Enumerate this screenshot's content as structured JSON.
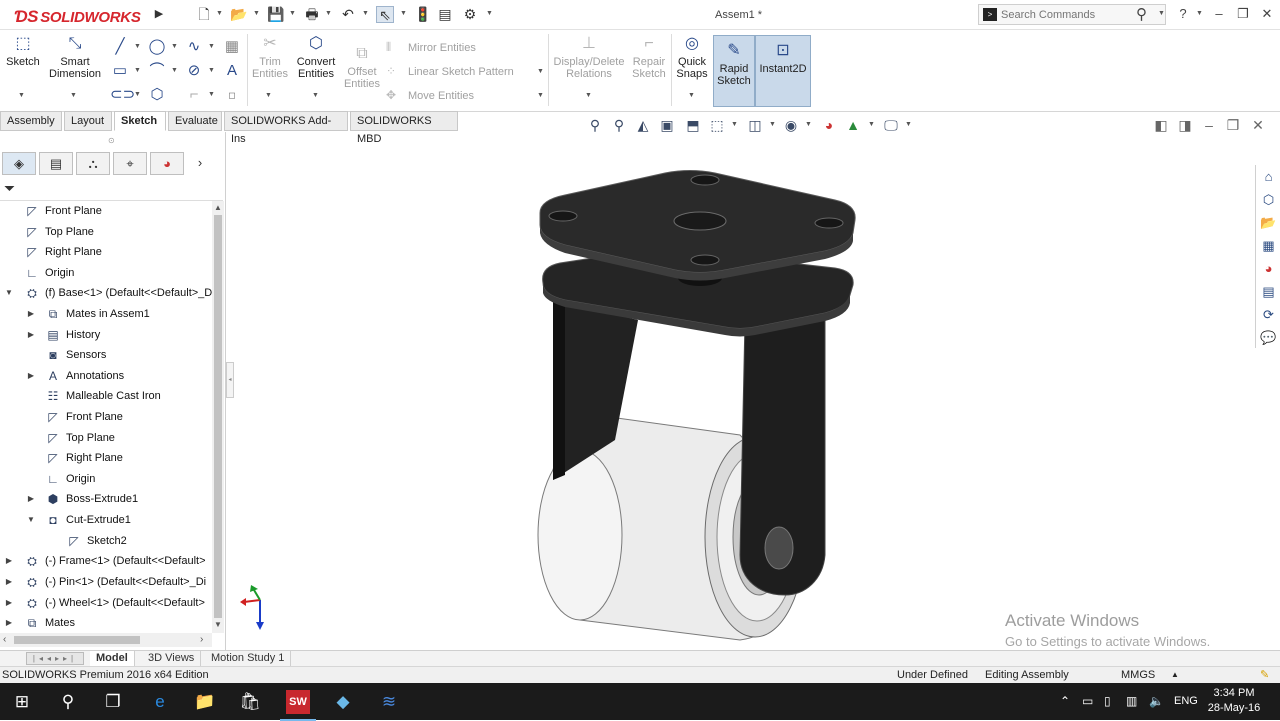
{
  "app": {
    "brand": "SOLIDWORKS",
    "document_title": "Assem1 *"
  },
  "search": {
    "placeholder": "Search Commands"
  },
  "titlebar": {
    "help": "?"
  },
  "command_manager": {
    "sketch": "Sketch",
    "smart_dimension": [
      "Smart",
      "Dimension"
    ],
    "trim_entities": [
      "Trim",
      "Entities"
    ],
    "convert_entities": [
      "Convert",
      "Entities"
    ],
    "offset_entities": [
      "Offset",
      "Entities"
    ],
    "mirror_entities": "Mirror Entities",
    "linear_sketch_pattern": "Linear Sketch Pattern",
    "move_entities": "Move Entities",
    "display_delete_relations": [
      "Display/Delete",
      "Relations"
    ],
    "repair_sketch": [
      "Repair",
      "Sketch"
    ],
    "quick_snaps": [
      "Quick",
      "Snaps"
    ],
    "rapid_sketch": [
      "Rapid",
      "Sketch"
    ],
    "instant2d": "Instant2D"
  },
  "tabs": [
    "Assembly",
    "Layout",
    "Sketch",
    "Evaluate",
    "SOLIDWORKS Add-Ins",
    "SOLIDWORKS MBD"
  ],
  "active_tab": "Sketch",
  "tree": [
    {
      "label": "Front Plane"
    },
    {
      "label": "Top Plane"
    },
    {
      "label": "Right Plane"
    },
    {
      "label": "Origin"
    },
    {
      "label": "(f) Base<1> (Default<<Default>_D"
    },
    {
      "label": "Mates in Assem1"
    },
    {
      "label": "History"
    },
    {
      "label": "Sensors"
    },
    {
      "label": "Annotations"
    },
    {
      "label": "Malleable Cast Iron"
    },
    {
      "label": "Front Plane"
    },
    {
      "label": "Top Plane"
    },
    {
      "label": "Right Plane"
    },
    {
      "label": "Origin"
    },
    {
      "label": "Boss-Extrude1"
    },
    {
      "label": "Cut-Extrude1"
    },
    {
      "label": "Sketch2"
    },
    {
      "label": "(-) Frame<1> (Default<<Default>"
    },
    {
      "label": "(-) Pin<1> (Default<<Default>_Di"
    },
    {
      "label": "(-) Wheel<1> (Default<<Default>"
    },
    {
      "label": "Mates"
    }
  ],
  "bottom_tabs": [
    "Model",
    "3D Views",
    "Motion Study 1"
  ],
  "active_bottom_tab": "Model",
  "status": {
    "edition": "SOLIDWORKS Premium 2016 x64 Edition",
    "definition": "Under Defined",
    "mode": "Editing Assembly",
    "units": "MMGS"
  },
  "watermark": {
    "title": "Activate Windows",
    "subtitle": "Go to Settings to activate Windows."
  },
  "taskbar": {
    "language": "ENG",
    "time": "3:34 PM",
    "date": "28-May-16"
  },
  "colors": {
    "brand_red": "#d6262d",
    "caster_frame": "#222222",
    "wheel": "#e9e9e9"
  }
}
